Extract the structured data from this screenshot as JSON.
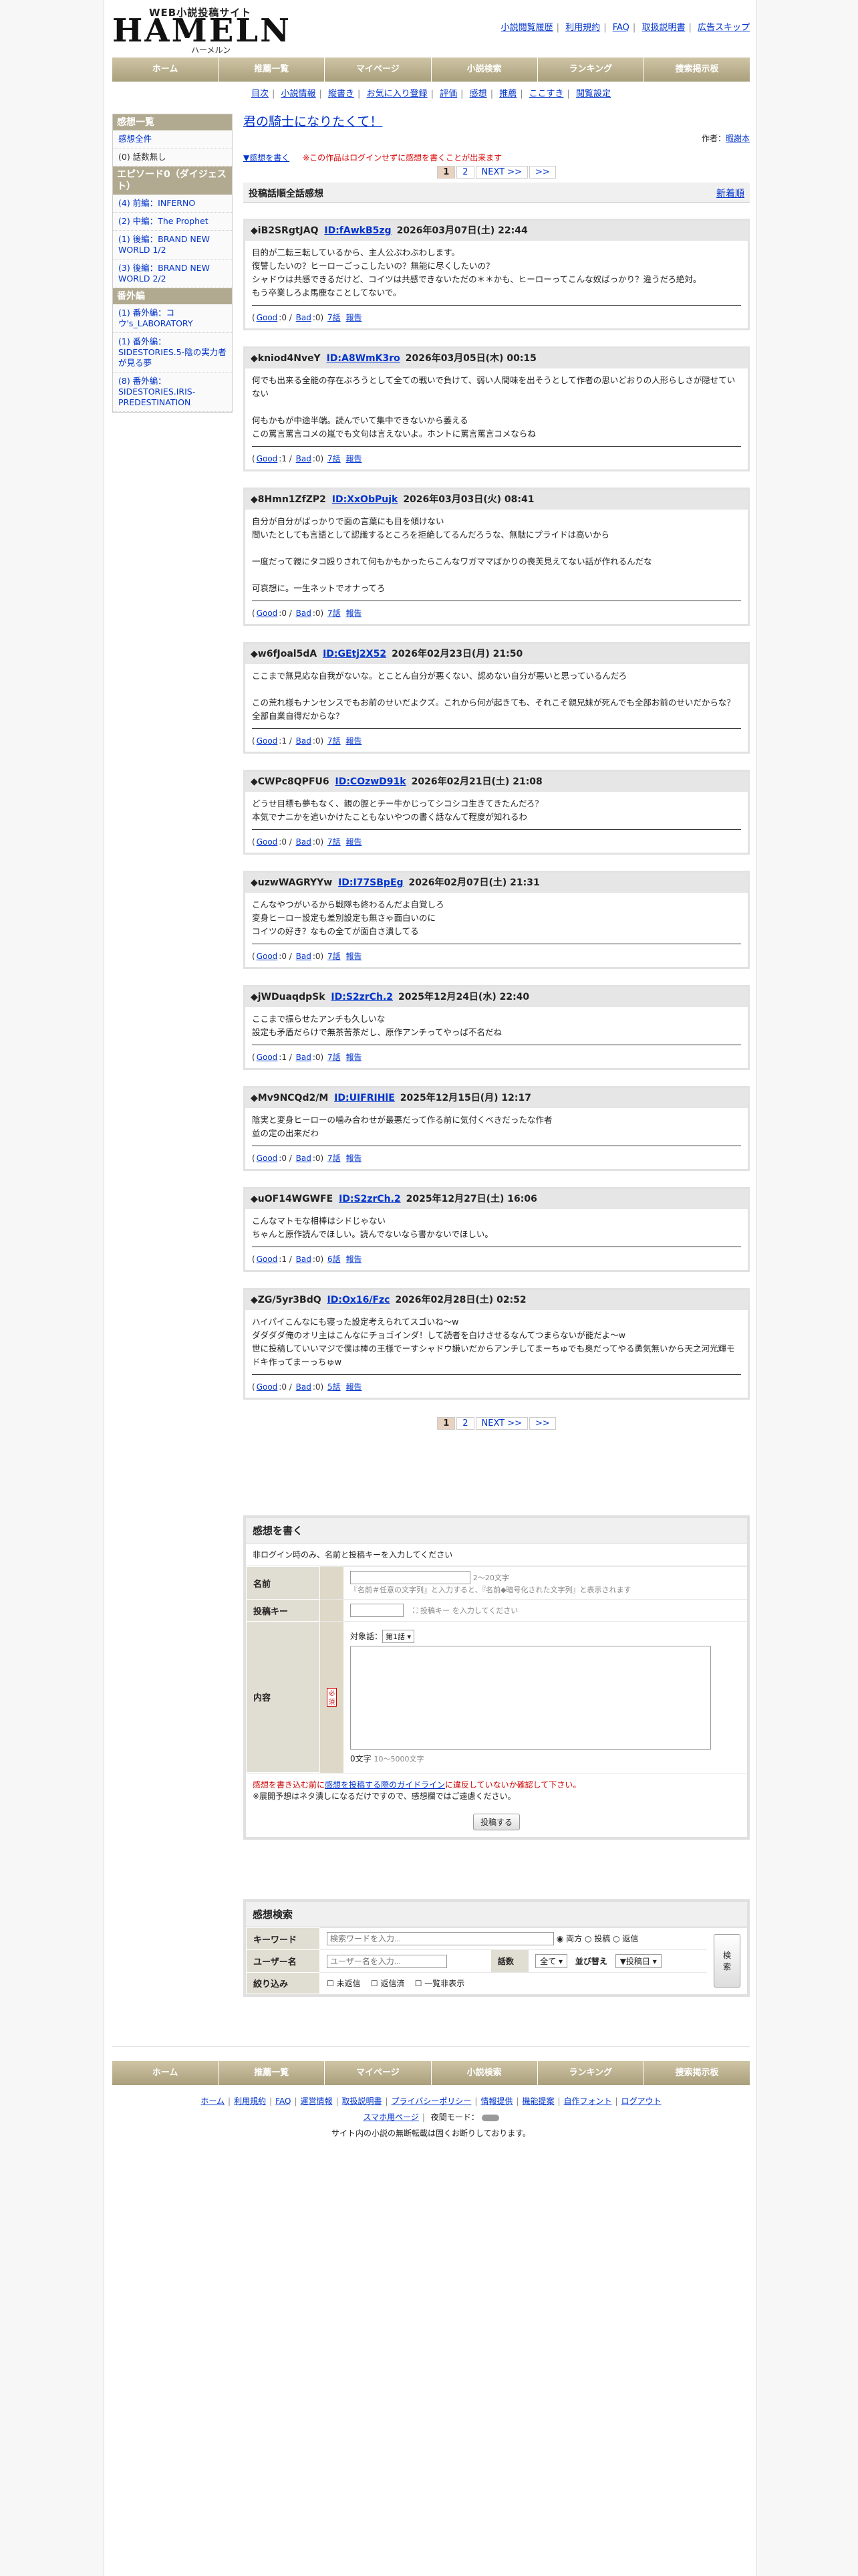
{
  "site": {
    "tagline": "WEB小説投稿サイト",
    "logo": "HAMELN",
    "logo_kana": "ハーメルン",
    "top_links": [
      "小説閲覧履歴",
      "利用規約",
      "FAQ",
      "取扱説明書",
      "広告スキップ"
    ]
  },
  "gnav": [
    "ホーム",
    "推薦一覧",
    "マイページ",
    "小説検索",
    "ランキング",
    "捜索掲示板"
  ],
  "subnav": [
    "目次",
    "小説情報",
    "縦書き",
    "お気に入り登録",
    "評価",
    "感想",
    "推薦",
    "ここすき",
    "閲覧設定"
  ],
  "sidebar": {
    "sections": [
      {
        "title": "感想一覧",
        "items": [
          "感想全件",
          "(0) 話数無し"
        ]
      },
      {
        "title": "エピソード0（ダイジェスト）",
        "items": [
          "(4) 前編：INFERNO",
          "(2) 中編：The Prophet",
          "(1) 後編：BRAND NEW WORLD 1/2",
          "(3) 後編：BRAND NEW WORLD 2/2"
        ]
      },
      {
        "title": "番外編",
        "items": [
          "(1) 番外編：コウ's_LABORATORY",
          "(1) 番外編：SIDESTORIES.5-陰の実力者が見る夢",
          "(8) 番外編：SIDESTORIES.IRIS-PREDESTINATION"
        ]
      }
    ]
  },
  "novel": {
    "title": "君の騎士になりたくて！",
    "author_label": "作者：",
    "author": "暇謝本",
    "write_link": "▼感想を書く",
    "warning": "※この作品はログインせずに感想を書くことが出来ます",
    "pager": [
      "1",
      "2",
      "NEXT >>",
      ">>"
    ],
    "section_title": "投稿話順全話感想",
    "sort": "新着順"
  },
  "reviews": [
    {
      "name": "◆iB2SRgtJAQ",
      "id": "ID:fAwkB5zg",
      "date": "2026年03月07日(土) 22:44",
      "lines": [
        "目的が二転三転しているから、主人公ぶわぶわします。",
        "復讐したいの？ヒーローごっこしたいの？無能に尽くしたいの？",
        "シャドウは共感できるだけど、コイツは共感できないただの＊＊かも、ヒーローってこんな奴ばっかり？違うだろ絶対。",
        "もう卒業しろよ馬鹿なことしてないで。"
      ],
      "good": "0",
      "bad": "0",
      "ep": "7話",
      "report": "報告"
    },
    {
      "name": "◆kniod4NveY",
      "id": "ID:A8WmK3ro",
      "date": "2026年03月05日(木) 00:15",
      "lines": [
        "何でも出来る全能の存在ぶろうとして全ての戦いで負けて、弱い人間味を出そうとして作者の思いどおりの人形らしさが隠せていない",
        "",
        "何もかもが中途半端。読んでいて集中できないから萎える",
        "この罵言罵言コメの嵐でも文句は言えないよ。ホントに罵言罵言コメならね"
      ],
      "good": "1",
      "bad": "0",
      "ep": "7話",
      "report": "報告"
    },
    {
      "name": "◆8Hmn1ZfZP2",
      "id": "ID:XxObPujk",
      "date": "2026年03月03日(火) 08:41",
      "lines": [
        "自分が自分がばっかりで面の言葉にも目を傾けない",
        "間いたとしても言語として認識するところを拒絶してるんだろうな、無駄にプライドは高いから",
        "",
        "一度だって親にタコ殴りされて何もかもかったらこんなワガママばかりの喪芙見えてない話が作れるんだな",
        "",
        "可哀想に。一生ネットでオナってろ"
      ],
      "good": "0",
      "bad": "0",
      "ep": "7話",
      "report": "報告"
    },
    {
      "name": "◆w6fJoal5dA",
      "id": "ID:GEtj2X52",
      "date": "2026年02月23日(月) 21:50",
      "lines": [
        "ここまで無見応な自我がないな。とことん自分が悪くない、認めない自分が悪いと思っているんだろ",
        "",
        "この荒れ様もナンセンスでもお前のせいだよクズ。これから何が起きても、それこそ親兄妹が死んでも全部お前のせいだからな？全部自業自得だからな？"
      ],
      "good": "1",
      "bad": "0",
      "ep": "7話",
      "report": "報告"
    },
    {
      "name": "◆CWPc8QPFU6",
      "id": "ID:COzwD91k",
      "date": "2026年02月21日(土) 21:08",
      "lines": [
        "どうせ目標も夢もなく、親の脛とチー牛かじってシコシコ生きてきたんだろ？",
        "本気でナニかを追いかけたこともないやつの書く話なんて程度が知れるわ"
      ],
      "good": "0",
      "bad": "0",
      "ep": "7話",
      "report": "報告"
    },
    {
      "name": "◆uzwWAGRYYw",
      "id": "ID:I77SBpEg",
      "date": "2026年02月07日(土) 21:31",
      "lines": [
        "こんなやつがいるから戦隊も終わるんだよ自覚しろ",
        "変身ヒーロー設定も差別設定も無さゃ面白いのに",
        "コイツの好き？なもの全てが面白さ潰してる"
      ],
      "good": "0",
      "bad": "0",
      "ep": "7話",
      "report": "報告"
    },
    {
      "name": "◆jWDuaqdpSk",
      "id": "ID:S2zrCh.2",
      "date": "2025年12月24日(水) 22:40",
      "lines": [
        "ここまで振らせたアンチも久しいな",
        "設定も矛盾だらけで無茶苦茶だし、原作アンチってやっぱ不名だね"
      ],
      "good": "1",
      "bad": "0",
      "ep": "7話",
      "report": "報告"
    },
    {
      "name": "◆Mv9NCQd2/M",
      "id": "ID:UIFRIHlE",
      "date": "2025年12月15日(月) 12:17",
      "lines": [
        "陰実と変身ヒーローの噛み合わせが最悪だって作る前に気付くべきだったな作者",
        "並の定の出来だわ"
      ],
      "good": "0",
      "bad": "0",
      "ep": "7話",
      "report": "報告"
    },
    {
      "name": "◆uOF14WGWFE",
      "id": "ID:S2zrCh.2",
      "date": "2025年12月27日(土) 16:06",
      "lines": [
        "こんなマトモな相棒はシドじゃない",
        "ちゃんと原作読んでほしい。読んでないなら書かないでほしい。"
      ],
      "good": "1",
      "bad": "0",
      "ep": "6話",
      "report": "報告"
    },
    {
      "name": "◆ZG/5yr3BdQ",
      "id": "ID:Ox16/Fzc",
      "date": "2026年02月28日(土) 02:52",
      "lines": [
        "ハイパイこんなにも寝った設定考えられてスゴいね〜w",
        "ダダダダ俺のオリ主はこんなにチョゴインダ！して読者を白けさせるなんてつまらないが能だよ〜w",
        "世に投稿していいマジで僕は棒の王様でーすシャドウ嫌いだからアンチしてまーちゅでも奥だってやる勇気無いから天之河光輝モドキ作ってまーっちゅw"
      ],
      "good": "0",
      "bad": "0",
      "ep": "5話",
      "report": "報告"
    }
  ],
  "review_labels": {
    "good": "Good",
    "bad": "Bad"
  },
  "form": {
    "title": "感想を書く",
    "note": "非ログイン時のみ、名前と投稿キーを入力してください",
    "name_label": "名前",
    "name_hint": "2〜20文字",
    "name_hint2": "『名前＃任意の文字列』と入力すると、『名前◆暗号化された文字列』と表示されます",
    "key_label": "投稿キー",
    "key_image_alt": "投稿キー",
    "key_hint": "を入力してください",
    "content_label": "内容",
    "required": "必須",
    "target_label": "対象話：",
    "target_value": "第1話",
    "count": "0文字",
    "count_hint": "10〜5000文字",
    "guide_pre": "感想を書き込む前に",
    "guide_link": "感想を投稿する際のガイドライン",
    "guide_post": "に違反していないか確認して下さい。",
    "note2": "※展開予想はネタ潰しになるだけですので、感想欄ではご遠慮ください。",
    "submit": "投稿する"
  },
  "search": {
    "title": "感想検索",
    "keyword_label": "キーワード",
    "keyword_placeholder": "検索ワードを入力...",
    "radios": [
      "両方",
      "投稿",
      "返信"
    ],
    "user_label": "ユーザー名",
    "user_placeholder": "ユーザー名を入力...",
    "episode_label": "話数",
    "episode_value": "全て",
    "sort_label": "並び替え",
    "sort_value": "▼投稿日",
    "search_button": "検索",
    "filter_label": "絞り込み",
    "checks": [
      "未返信",
      "返信済",
      "一覧非表示"
    ]
  },
  "footer": {
    "links": [
      "ホーム",
      "利用規約",
      "FAQ",
      "運営情報",
      "取扱説明書",
      "プライバシーポリシー",
      "情報提供",
      "機能提案",
      "自作フォント",
      "ログアウト"
    ],
    "mobile": "スマホ用ページ",
    "night_label": "夜間モード：",
    "copyright": "サイト内の小説の無断転載は固くお断りしております。"
  }
}
